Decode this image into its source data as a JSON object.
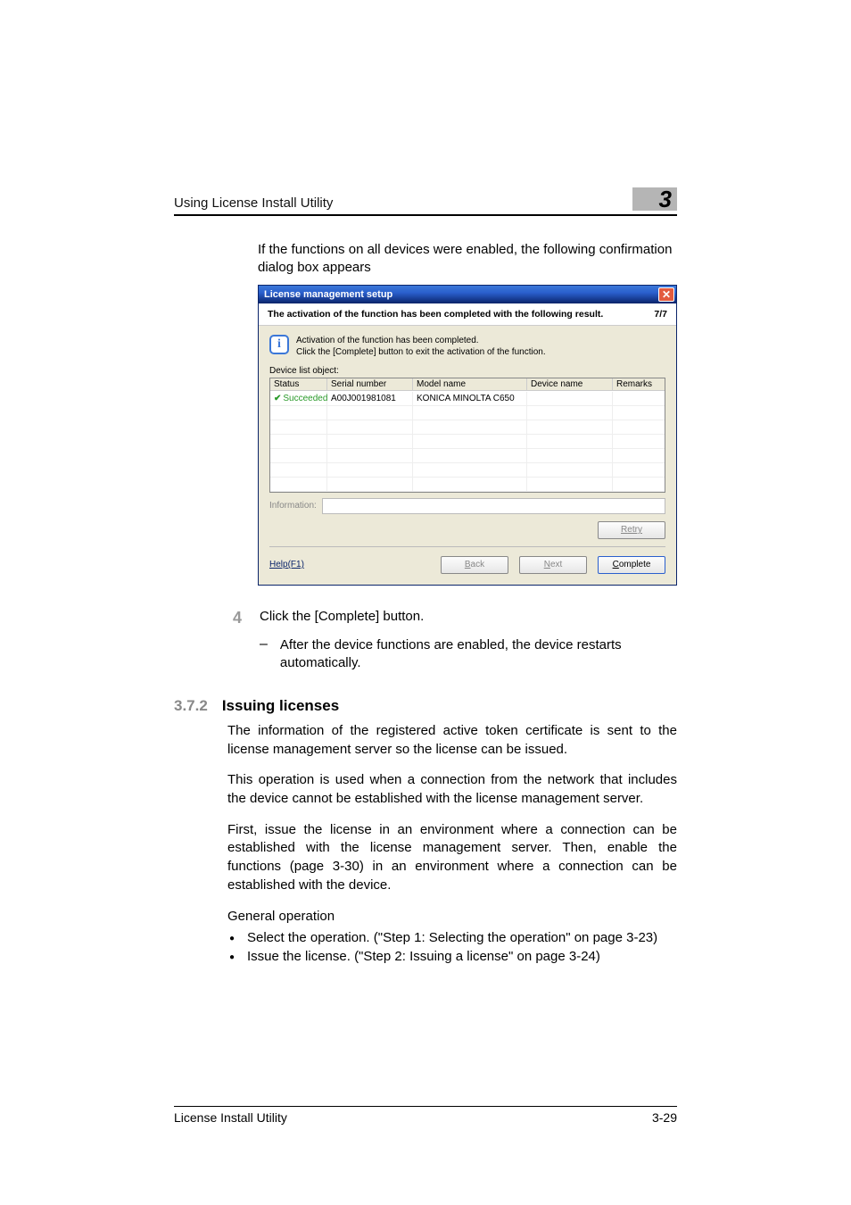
{
  "header": {
    "title": "Using License Install Utility",
    "section_number": "3"
  },
  "intro": "If the functions on all devices were enabled, the following confirmation dialog box appears",
  "dialog": {
    "title": "License management setup",
    "close_glyph": "✕",
    "completed_text": "The activation of the function has been completed with the following result.",
    "step_indicator": "7/7",
    "info_glyph": "i",
    "info_line1": "Activation of the function has been completed.",
    "info_line2": "Click the [Complete] button to exit the activation of the function.",
    "device_list_label": "Device list object:",
    "columns": {
      "c1": "Status",
      "c2": "Serial number",
      "c3": "Model name",
      "c4": "Device name",
      "c5": "Remarks"
    },
    "row": {
      "status": "Succeeded",
      "serial": "A00J001981081",
      "model": "KONICA MINOLTA C650",
      "device": "",
      "remarks": ""
    },
    "info_label": "Information:",
    "retry": "Retry",
    "help": "Help(F1)",
    "back": "Back",
    "next": "Next",
    "complete": "Complete"
  },
  "step4": {
    "num": "4",
    "text": "Click the [Complete] button.",
    "sub_dash": "–",
    "sub_text": "After the device functions are enabled, the device restarts automatically."
  },
  "section": {
    "num": "3.7.2",
    "title": "Issuing licenses",
    "p1": "The information of the registered active token certificate is sent to the license management server so the license can be issued.",
    "p2": "This operation is used when a connection from the network that includes the device cannot be established with the license management server.",
    "p3": "First, issue the license in an environment where a connection can be established with the license management server. Then, enable the functions (page 3-30) in an environment where a connection can be established with the device.",
    "general": "General operation",
    "b1": "Select the operation. (\"Step 1: Selecting the operation\" on page 3-23)",
    "b2": "Issue the license. (\"Step 2: Issuing a license\" on page 3-24)"
  },
  "footer": {
    "left": "License Install Utility",
    "right": "3-29"
  }
}
